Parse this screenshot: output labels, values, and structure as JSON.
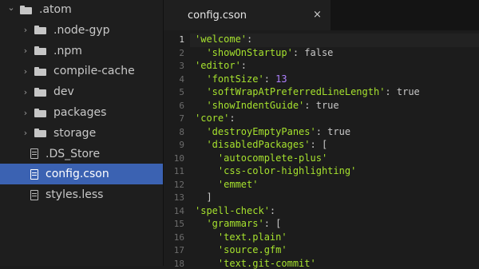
{
  "tree": {
    "items": [
      {
        "label": ".atom",
        "kind": "folder",
        "expanded": true,
        "depth": 0,
        "selected": false
      },
      {
        "label": ".node-gyp",
        "kind": "folder",
        "expanded": false,
        "depth": 1,
        "selected": false
      },
      {
        "label": ".npm",
        "kind": "folder",
        "expanded": false,
        "depth": 1,
        "selected": false
      },
      {
        "label": "compile-cache",
        "kind": "folder",
        "expanded": false,
        "depth": 1,
        "selected": false
      },
      {
        "label": "dev",
        "kind": "folder",
        "expanded": false,
        "depth": 1,
        "selected": false
      },
      {
        "label": "packages",
        "kind": "folder",
        "expanded": false,
        "depth": 1,
        "selected": false
      },
      {
        "label": "storage",
        "kind": "folder",
        "expanded": false,
        "depth": 1,
        "selected": false
      },
      {
        "label": ".DS_Store",
        "kind": "file",
        "depth": 1,
        "selected": false
      },
      {
        "label": "config.cson",
        "kind": "file",
        "depth": 1,
        "selected": true
      },
      {
        "label": "styles.less",
        "kind": "file",
        "depth": 1,
        "selected": false
      }
    ]
  },
  "editor": {
    "tab": {
      "title": "config.cson",
      "close": "×"
    },
    "active_line": 1,
    "lines": [
      [
        {
          "t": "'welcome'",
          "c": "k"
        },
        {
          "t": ":",
          "c": "w"
        }
      ],
      [
        {
          "t": "  ",
          "c": "w"
        },
        {
          "t": "'showOnStartup'",
          "c": "k"
        },
        {
          "t": ": false",
          "c": "w"
        }
      ],
      [
        {
          "t": "'editor'",
          "c": "k"
        },
        {
          "t": ":",
          "c": "w"
        }
      ],
      [
        {
          "t": "  ",
          "c": "w"
        },
        {
          "t": "'fontSize'",
          "c": "k"
        },
        {
          "t": ": ",
          "c": "w"
        },
        {
          "t": "13",
          "c": "n"
        }
      ],
      [
        {
          "t": "  ",
          "c": "w"
        },
        {
          "t": "'softWrapAtPreferredLineLength'",
          "c": "k"
        },
        {
          "t": ": true",
          "c": "w"
        }
      ],
      [
        {
          "t": "  ",
          "c": "w"
        },
        {
          "t": "'showIndentGuide'",
          "c": "k"
        },
        {
          "t": ": true",
          "c": "w"
        }
      ],
      [
        {
          "t": "'core'",
          "c": "k"
        },
        {
          "t": ":",
          "c": "w"
        }
      ],
      [
        {
          "t": "  ",
          "c": "w"
        },
        {
          "t": "'destroyEmptyPanes'",
          "c": "k"
        },
        {
          "t": ": true",
          "c": "w"
        }
      ],
      [
        {
          "t": "  ",
          "c": "w"
        },
        {
          "t": "'disabledPackages'",
          "c": "k"
        },
        {
          "t": ": [",
          "c": "w"
        }
      ],
      [
        {
          "t": "    ",
          "c": "w"
        },
        {
          "t": "'autocomplete-plus'",
          "c": "k"
        }
      ],
      [
        {
          "t": "    ",
          "c": "w"
        },
        {
          "t": "'css-color-highlighting'",
          "c": "k"
        }
      ],
      [
        {
          "t": "    ",
          "c": "w"
        },
        {
          "t": "'emmet'",
          "c": "k"
        }
      ],
      [
        {
          "t": "  ]",
          "c": "w"
        }
      ],
      [
        {
          "t": "'spell-check'",
          "c": "k"
        },
        {
          "t": ":",
          "c": "w"
        }
      ],
      [
        {
          "t": "  ",
          "c": "w"
        },
        {
          "t": "'grammars'",
          "c": "k"
        },
        {
          "t": ": [",
          "c": "w"
        }
      ],
      [
        {
          "t": "    ",
          "c": "w"
        },
        {
          "t": "'text.plain'",
          "c": "k"
        }
      ],
      [
        {
          "t": "    ",
          "c": "w"
        },
        {
          "t": "'source.gfm'",
          "c": "k"
        }
      ],
      [
        {
          "t": "    ",
          "c": "w"
        },
        {
          "t": "'text.git-commit'",
          "c": "k"
        }
      ]
    ]
  }
}
